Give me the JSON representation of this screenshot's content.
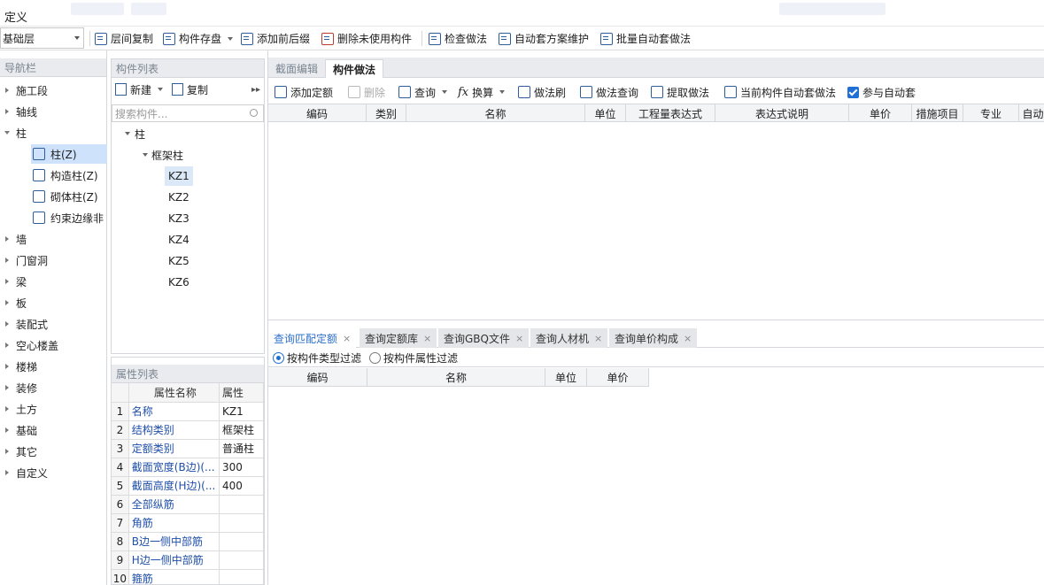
{
  "menu": {
    "title": "定义"
  },
  "toolbar": {
    "floor": "基础层",
    "items": [
      "层间复制",
      "构件存盘",
      "添加前后缀",
      "删除未使用构件",
      "检查做法",
      "自动套方案维护",
      "批量自动套做法"
    ]
  },
  "nav": {
    "title": "导航栏",
    "groups": [
      "施工段",
      "轴线",
      "柱",
      "墙",
      "门窗洞",
      "梁",
      "板",
      "装配式",
      "空心楼盖",
      "楼梯",
      "装修",
      "土方",
      "基础",
      "其它",
      "自定义"
    ],
    "column_items": [
      "柱(Z)",
      "构造柱(Z)",
      "砌体柱(Z)",
      "约束边缘非"
    ]
  },
  "complist": {
    "title": "构件列表",
    "new_label": "新建",
    "copy_label": "复制",
    "search_placeholder": "搜索构件...",
    "tree_root": "柱",
    "tree_group": "框架柱",
    "items": [
      "KZ1",
      "KZ2",
      "KZ3",
      "KZ4",
      "KZ5",
      "KZ6"
    ]
  },
  "props": {
    "title": "属性列表",
    "headers": [
      "属性名称",
      "属性"
    ],
    "rows": [
      {
        "n": "1",
        "name": "名称",
        "value": "KZ1"
      },
      {
        "n": "2",
        "name": "结构类别",
        "value": "框架柱"
      },
      {
        "n": "3",
        "name": "定额类别",
        "value": "普通柱"
      },
      {
        "n": "4",
        "name": "截面宽度(B边)(...",
        "value": "300"
      },
      {
        "n": "5",
        "name": "截面高度(H边)(...",
        "value": "400"
      },
      {
        "n": "6",
        "name": "全部纵筋",
        "value": ""
      },
      {
        "n": "7",
        "name": "角筋",
        "value": ""
      },
      {
        "n": "8",
        "name": "B边一侧中部筋",
        "value": ""
      },
      {
        "n": "9",
        "name": "H边一侧中部筋",
        "value": ""
      },
      {
        "n": "10",
        "name": "箍筋",
        "value": ""
      }
    ]
  },
  "right": {
    "tabs": [
      "截面编辑",
      "构件做法"
    ],
    "actions": [
      "添加定额",
      "删除",
      "查询",
      "换算",
      "做法刷",
      "做法查询",
      "提取做法",
      "当前构件自动套做法",
      "参与自动套"
    ],
    "columns": [
      "编码",
      "类别",
      "名称",
      "单位",
      "工程量表达式",
      "表达式说明",
      "单价",
      "措施项目",
      "专业",
      "自动"
    ],
    "bottom_tabs": [
      "查询匹配定额",
      "查询定额库",
      "查询GBQ文件",
      "查询人材机",
      "查询单价构成"
    ],
    "filters": [
      "按构件类型过滤",
      "按构件属性过滤"
    ],
    "bottom_columns": [
      "编码",
      "名称",
      "单位",
      "单价"
    ]
  }
}
